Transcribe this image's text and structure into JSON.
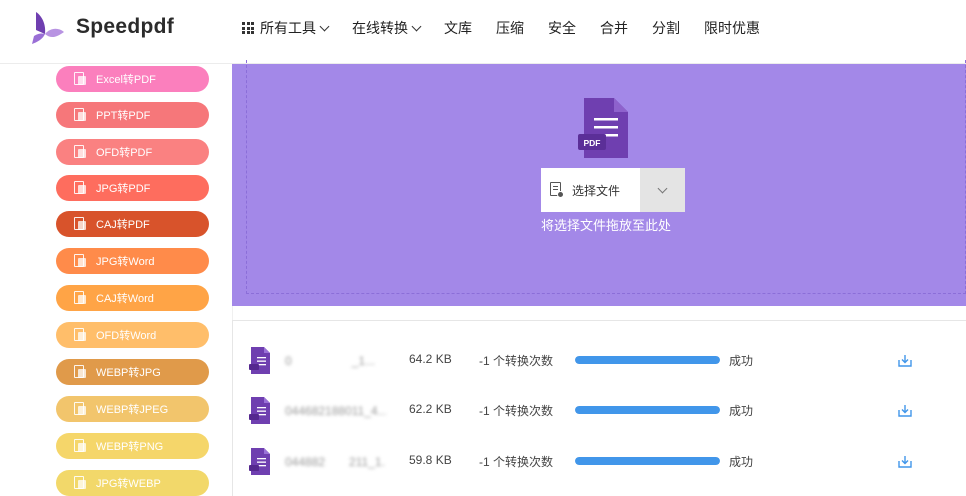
{
  "brand": {
    "name": "Speedpdf"
  },
  "nav": {
    "all_tools": "所有工具",
    "online_convert": "在线转换",
    "library": "文库",
    "compress": "压缩",
    "security": "安全",
    "merge": "合并",
    "split": "分割",
    "promo": "限时优惠"
  },
  "sidebar": {
    "items": [
      {
        "label": "Excel转PDF",
        "color": "#fb7fbd"
      },
      {
        "label": "PPT转PDF",
        "color": "#f6777a"
      },
      {
        "label": "OFD转PDF",
        "color": "#fa8181"
      },
      {
        "label": "JPG转PDF",
        "color": "#fe6d5e"
      },
      {
        "label": "CAJ转PDF",
        "color": "#d8532b"
      },
      {
        "label": "JPG转Word",
        "color": "#ff8b4a"
      },
      {
        "label": "CAJ转Word",
        "color": "#ffa446"
      },
      {
        "label": "OFD转Word",
        "color": "#ffbe6a"
      },
      {
        "label": "WEBP转JPG",
        "color": "#e09a4a"
      },
      {
        "label": "WEBP转JPEG",
        "color": "#f2c56c"
      },
      {
        "label": "WEBP转PNG",
        "color": "#f5d66a"
      },
      {
        "label": "JPG转WEBP",
        "color": "#f2d86a"
      }
    ]
  },
  "upload": {
    "pdf_badge": "PDF",
    "choose_label": "选择文件",
    "drop_hint": "将选择文件拖放至此处",
    "bg_color": "#a388e8"
  },
  "files": [
    {
      "name": "0     _1...",
      "size": "64.2 KB",
      "count": "-1 个转换次数",
      "progress": 1.0,
      "status": "成功"
    },
    {
      "name": "044682188011_4...",
      "size": "62.2 KB",
      "count": "-1 个转换次数",
      "progress": 1.0,
      "status": "成功"
    },
    {
      "name": "044882  211_1...",
      "size": "59.8 KB",
      "count": "-1 个转换次数",
      "progress": 1.0,
      "status": "成功"
    }
  ],
  "icons": {
    "logo": "speedpdf-logo-icon",
    "tools": "grid-icon",
    "dropdown": "chevron-down-icon",
    "file": "file-icon",
    "pdf": "pdf-file-icon",
    "download": "download-icon"
  }
}
